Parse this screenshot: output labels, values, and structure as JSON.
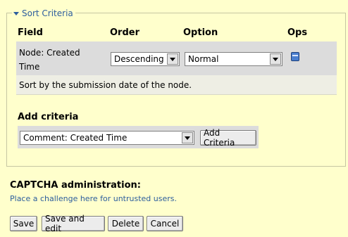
{
  "sort_criteria": {
    "legend": "Sort Criteria",
    "headers": {
      "field": "Field",
      "order": "Order",
      "option": "Option",
      "ops": "Ops"
    },
    "row": {
      "field_line1": "Node: Created",
      "field_line2": "Time",
      "order_value": "Descending",
      "option_value": "Normal",
      "ops_icon": "delete-icon",
      "description": "Sort by the submission date of the node."
    },
    "add": {
      "label": "Add criteria",
      "select_value": "Comment: Created Time",
      "button_label": "Add Criteria"
    }
  },
  "captcha": {
    "title": "CAPTCHA administration:",
    "link": "Place a challenge here for untrusted users."
  },
  "actions": {
    "save": "Save",
    "save_and_edit": "Save and edit",
    "delete": "Delete",
    "cancel": "Cancel"
  }
}
